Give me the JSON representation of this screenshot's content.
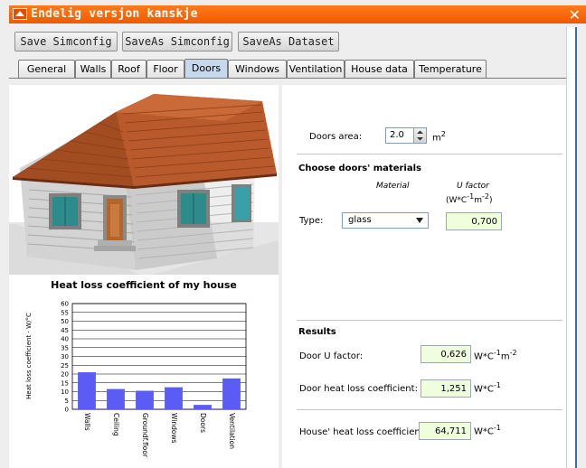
{
  "window": {
    "title": "Endelig versjon kanskje"
  },
  "toolbar": {
    "save": "Save Simconfig",
    "save_as": "SaveAs Simconfig",
    "save_as_dataset": "SaveAs Dataset"
  },
  "tabs": [
    "General",
    "Walls",
    "Roof",
    "Floor",
    "Doors",
    "Windows",
    "Ventilation",
    "House data",
    "Temperature"
  ],
  "active_tab": "Doors",
  "doors": {
    "area_label": "Doors area:",
    "area_value": "2.0",
    "area_unit": "m",
    "area_unit_exp": "2",
    "materials_heading": "Choose doors' materials",
    "material_col": "Material",
    "ufactor_col": "U factor",
    "ufactor_unit": "(W*C",
    "ufactor_unit_exp1": "-1",
    "ufactor_unit_mid": "m",
    "ufactor_unit_exp2": "-2",
    "ufactor_unit_close": ")",
    "type_label": "Type:",
    "type_value": "glass",
    "type_ufactor": "0,700"
  },
  "results": {
    "heading": "Results",
    "door_u_label": "Door U factor:",
    "door_u_value": "0,626",
    "door_u_unit": "W*C",
    "door_u_unit_exp1": "-1",
    "door_u_unit_m": "m",
    "door_u_unit_exp2": "-2",
    "door_heat_label": "Door heat loss coefficient:",
    "door_heat_value": "1,251",
    "door_heat_unit": "W*C",
    "door_heat_unit_exp": "-1",
    "house_heat_label": "House' heat loss coefficient:",
    "house_heat_value": "64,711",
    "house_heat_unit": "W*C",
    "house_heat_unit_exp": "-1"
  },
  "chart_data": {
    "type": "bar",
    "title": "Heat loss coefficient of my house",
    "ylabel": "Heat loss coefficient - W/°C",
    "xlabel": "",
    "ylim": [
      0,
      60
    ],
    "yticks": [
      "0",
      "5",
      "10",
      "15",
      "20",
      "25",
      "30",
      "35",
      "40",
      "45",
      "50",
      "55",
      "60"
    ],
    "categories": [
      "Walls",
      "Ceiling",
      "Groundf.floor",
      "Windows",
      "Doors",
      "Ventilation"
    ],
    "values": [
      21,
      11.5,
      10.5,
      12.5,
      2.5,
      17.5
    ],
    "bar_color": "#5b5bf5",
    "grid": true
  }
}
